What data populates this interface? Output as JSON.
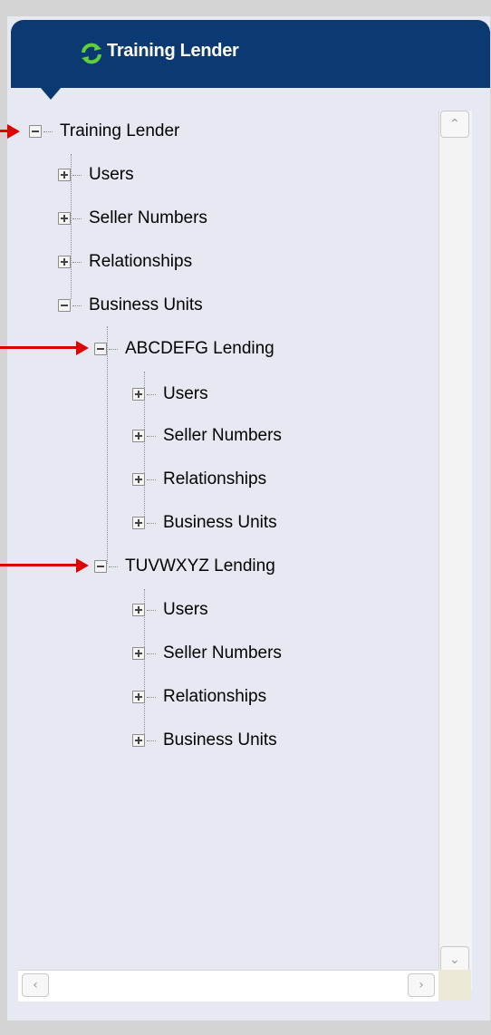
{
  "header": {
    "title": "Training Lender",
    "icon": "refresh-icon"
  },
  "tree": {
    "root": {
      "label": "Training Lender",
      "state": "expanded"
    },
    "root_children": [
      {
        "label": "Users",
        "state": "collapsed"
      },
      {
        "label": "Seller Numbers",
        "state": "collapsed"
      },
      {
        "label": "Relationships",
        "state": "collapsed"
      },
      {
        "label": "Business Units",
        "state": "expanded"
      }
    ],
    "business_units": [
      {
        "label": "ABCDEFG Lending",
        "state": "expanded",
        "children": [
          {
            "label": "Users"
          },
          {
            "label": "Seller Numbers"
          },
          {
            "label": "Relationships"
          },
          {
            "label": "Business Units"
          }
        ]
      },
      {
        "label": "TUVWXYZ Lending",
        "state": "expanded",
        "children": [
          {
            "label": "Users"
          },
          {
            "label": "Seller Numbers"
          },
          {
            "label": "Relationships"
          },
          {
            "label": "Business Units"
          }
        ]
      }
    ]
  },
  "colors": {
    "header_bg": "#0b3a73",
    "panel_bg": "#e6e9f1",
    "arrow": "#e00000"
  }
}
